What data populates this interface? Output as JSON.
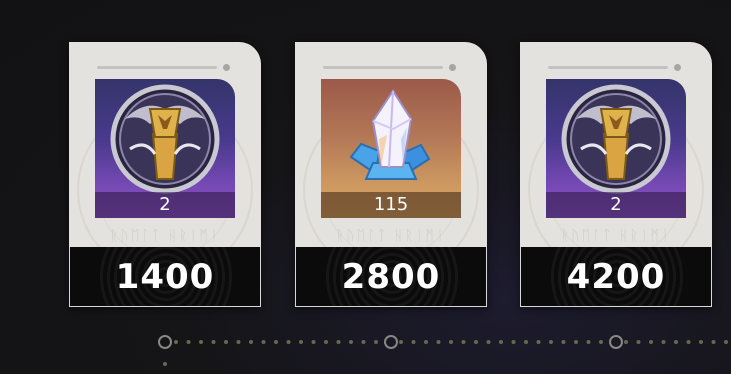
{
  "rewards": [
    {
      "item_icon": "ornate-token-icon",
      "count": "2",
      "price": "1400",
      "theme_color": "#7a4bb8"
    },
    {
      "item_icon": "crystal-icon",
      "count": "115",
      "price": "2800",
      "theme_color": "#cc9860"
    },
    {
      "item_icon": "ornate-token-icon",
      "count": "2",
      "price": "4200",
      "theme_color": "#7a4bb8"
    }
  ],
  "watermark_text": "ᚱᚢᛖᛚᛏ ᚺᚱᛁᛗᛁ",
  "colors": {
    "card_bg": "#e4e2df",
    "price_bg": "#0b0b0c",
    "timeline_dot": "#6b6650",
    "timeline_node": "#8a8882"
  }
}
